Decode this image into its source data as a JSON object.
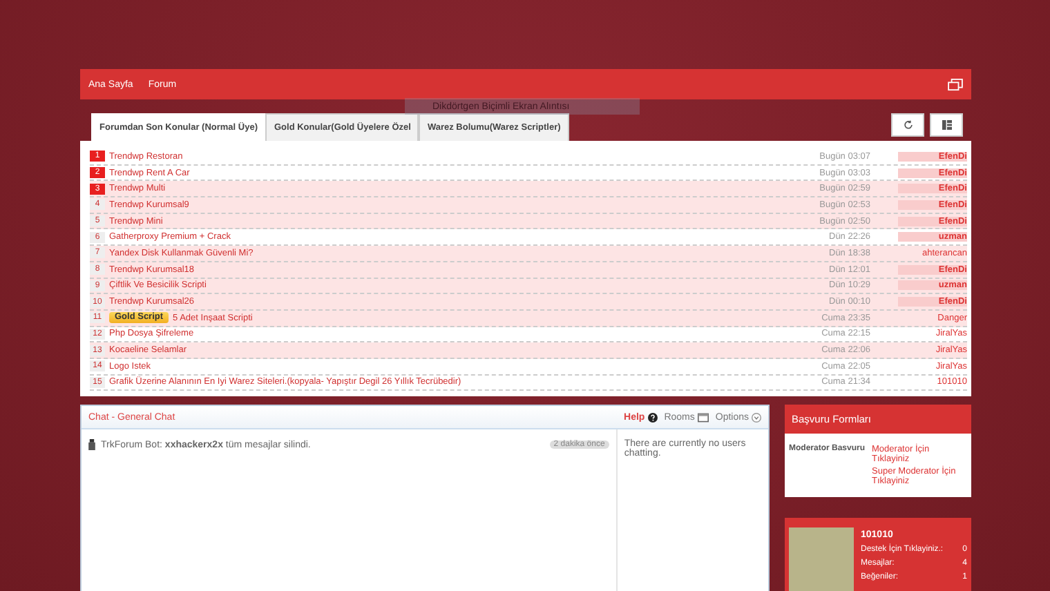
{
  "nav": {
    "items": [
      "Ana Sayfa",
      "Forum"
    ]
  },
  "overlay_label": "Dikdörtgen Biçimli Ekran Alıntısı",
  "tabs": [
    {
      "label": "Forumdan Son Konular (Normal Üye)",
      "selected": true
    },
    {
      "label": "Gold Konular(Gold Üyelere Özel",
      "selected": false
    },
    {
      "label": "Warez Bolumu(Warez Scriptler)",
      "selected": false
    }
  ],
  "topics": [
    {
      "rank": "1",
      "title": "Trendwp Restoran",
      "time": "Bugün 03:07",
      "user": "EfenDi",
      "top": true,
      "highlighted": false,
      "staff": true
    },
    {
      "rank": "2",
      "title": "Trendwp Rent A Car",
      "time": "Bugün 03:03",
      "user": "EfenDi",
      "top": true,
      "highlighted": false,
      "staff": true
    },
    {
      "rank": "3",
      "title": "Trendwp Multi",
      "time": "Bugün 02:59",
      "user": "EfenDi",
      "top": true,
      "highlighted": true,
      "staff": true
    },
    {
      "rank": "4",
      "title": "Trendwp Kurumsal9",
      "time": "Bugün 02:53",
      "user": "EfenDi",
      "top": false,
      "highlighted": true,
      "staff": true
    },
    {
      "rank": "5",
      "title": "Trendwp Mini",
      "time": "Bugün 02:50",
      "user": "EfenDi",
      "top": false,
      "highlighted": true,
      "staff": true
    },
    {
      "rank": "6",
      "title": "Gatherproxy Premium + Crack",
      "time": "Dün 22:26",
      "user": "uzman",
      "top": false,
      "highlighted": false,
      "staff": true
    },
    {
      "rank": "7",
      "title": "Yandex Disk Kullanmak Güvenli Mi?",
      "time": "Dün 18:38",
      "user": "ahterancan",
      "top": false,
      "highlighted": true,
      "staff": false
    },
    {
      "rank": "8",
      "title": "Trendwp Kurumsal18",
      "time": "Dün 12:01",
      "user": "EfenDi",
      "top": false,
      "highlighted": true,
      "staff": true
    },
    {
      "rank": "9",
      "title": "Çiftlik Ve Besicilik Scripti",
      "time": "Dün 10:29",
      "user": "uzman",
      "top": false,
      "highlighted": true,
      "staff": true
    },
    {
      "rank": "10",
      "title": "Trendwp Kurumsal26",
      "time": "Dün 00:10",
      "user": "EfenDi",
      "top": false,
      "highlighted": true,
      "staff": true
    },
    {
      "rank": "11",
      "prefix": "Gold Script",
      "title": "5 Adet Inşaat Scripti",
      "time": "Cuma 23:35",
      "user": "Danger",
      "top": false,
      "highlighted": true,
      "staff": false
    },
    {
      "rank": "12",
      "title": "Php Dosya Şifreleme",
      "time": "Cuma 22:15",
      "user": "JiralYas",
      "top": false,
      "highlighted": false,
      "staff": false
    },
    {
      "rank": "13",
      "title": "Kocaeline Selamlar",
      "time": "Cuma 22:06",
      "user": "JiralYas",
      "top": false,
      "highlighted": true,
      "staff": false
    },
    {
      "rank": "14",
      "title": "Logo Istek",
      "time": "Cuma 22:05",
      "user": "JiralYas",
      "top": false,
      "highlighted": false,
      "staff": false
    },
    {
      "rank": "15",
      "title": "Grafik Üzerine Alanının En Iyi Warez Siteleri.(kopyala- Yapıştır Degil 26 Yıllık Tecrübedir)",
      "time": "Cuma 21:34",
      "user": "101010",
      "top": false,
      "highlighted": false,
      "staff": false
    }
  ],
  "chat": {
    "title": "Chat - General Chat",
    "help": "Help",
    "rooms": "Rooms",
    "options": "Options",
    "message": "TrkForum Bot: **xxhackerx2x** tüm mesajlar silindi.",
    "message_time": "2 dakika önce",
    "users_note": "There are currently no users chatting."
  },
  "forms": {
    "title": "Başvuru Formları",
    "label": "Moderator Basvuru",
    "links": [
      "Moderator İçin Tıklayiniz",
      "Super Moderator İçin Tıklayiniz"
    ]
  },
  "profile": {
    "name": "101010",
    "stats": [
      {
        "label": "Destek İçin Tıklayiniz.:",
        "value": "0"
      },
      {
        "label": "Mesajlar:",
        "value": "4"
      },
      {
        "label": "Beğeniler:",
        "value": "1"
      }
    ]
  }
}
